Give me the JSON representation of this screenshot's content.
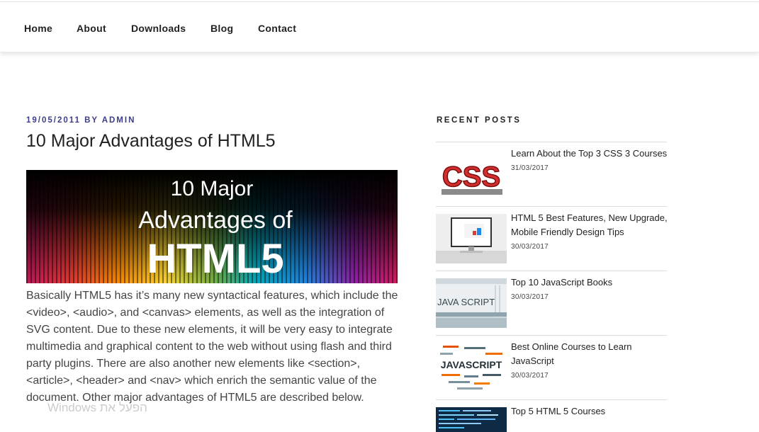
{
  "nav": {
    "items": [
      "Home",
      "About",
      "Downloads",
      "Blog",
      "Contact"
    ]
  },
  "post": {
    "date": "19/05/2011",
    "by": "BY",
    "author": "ADMIN",
    "title": "10 Major Advantages of HTML5",
    "image_text": [
      "10 Major",
      "Advantages of",
      "HTML5"
    ],
    "body": "Basically HTML5 has it’s many new syntactical features, which include the <video>, <audio>, and <canvas> elements, as well as the integration of SVG content. Due to these new elements, it will be very easy to integrate multimedia and graphical content to the web without using flash and third party plugins. There are also another new elements like <section>, <article>, <header> and <nav> which enrich the semantic value of the document. Other major advantages of HTML5 are described below."
  },
  "sidebar": {
    "title": "RECENT POSTS",
    "posts": [
      {
        "title": "Learn About the Top 3 CSS 3 Courses",
        "date": "31/03/2017",
        "thumb_text": "CSS"
      },
      {
        "title": "HTML 5 Best Features, New Upgrade, Mobile Friendly Design Tips",
        "date": "30/03/2017",
        "thumb_text": ""
      },
      {
        "title": "Top 10 JavaScript Books",
        "date": "30/03/2017",
        "thumb_text": "JAVA SCRIPT"
      },
      {
        "title": "Best Online Courses to Learn JavaScript",
        "date": "30/03/2017",
        "thumb_text": "JAVASCRIPT"
      },
      {
        "title": "Top 5 HTML 5 Courses",
        "date": "",
        "thumb_text": ""
      }
    ]
  },
  "watermark": "Windows הפעל את",
  "colors": {
    "meta": "#3d3d87",
    "text": "#222222",
    "border": "#dcdcdc"
  }
}
